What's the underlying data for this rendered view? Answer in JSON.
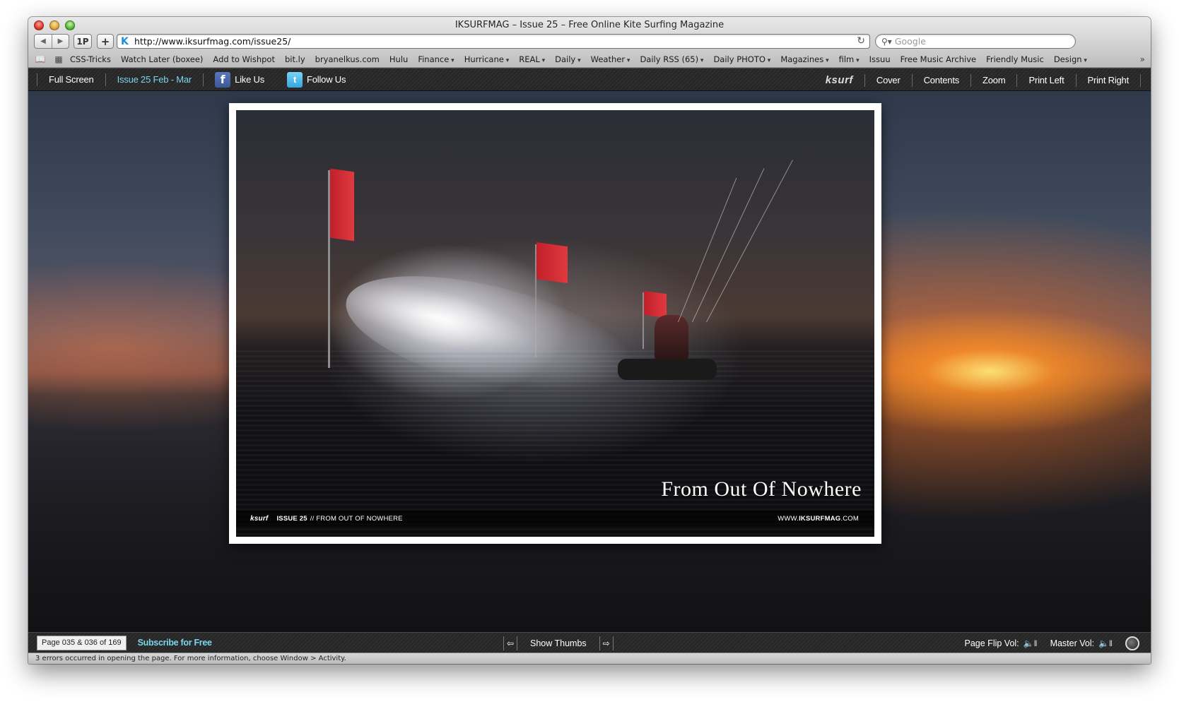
{
  "window": {
    "title": "IKSURFMAG – Issue 25 – Free Online Kite Surfing Magazine"
  },
  "toolbar": {
    "back_label": "◀",
    "forward_label": "▶",
    "onepass_label": "1P",
    "add_label": "+",
    "favicon": "K",
    "url": "http://www.iksurfmag.com/issue25/",
    "reload_icon": "↻",
    "search_placeholder": "Google"
  },
  "bookmarks": [
    {
      "label": "CSS-Tricks",
      "menu": false
    },
    {
      "label": "Watch Later (boxee)",
      "menu": false
    },
    {
      "label": "Add to Wishpot",
      "menu": false
    },
    {
      "label": "bit.ly",
      "menu": false
    },
    {
      "label": "bryanelkus.com",
      "menu": false
    },
    {
      "label": "Hulu",
      "menu": false
    },
    {
      "label": "Finance",
      "menu": true
    },
    {
      "label": "Hurricane",
      "menu": true
    },
    {
      "label": "REAL",
      "menu": true
    },
    {
      "label": "Daily",
      "menu": true
    },
    {
      "label": "Weather",
      "menu": true
    },
    {
      "label": "Daily RSS (65)",
      "menu": true
    },
    {
      "label": "Daily PHOTO",
      "menu": true
    },
    {
      "label": "Magazines",
      "menu": true
    },
    {
      "label": "film",
      "menu": true
    },
    {
      "label": "Issuu",
      "menu": false
    },
    {
      "label": "Free Music Archive",
      "menu": false
    },
    {
      "label": "Friendly Music",
      "menu": false
    },
    {
      "label": "Design",
      "menu": true
    }
  ],
  "app_nav": {
    "full_screen": "Full Screen",
    "issue": "Issue 25 Feb - Mar",
    "like": "Like Us",
    "follow": "Follow Us",
    "logo": "ksurf",
    "cover": "Cover",
    "contents": "Contents",
    "zoom": "Zoom",
    "print_left": "Print Left",
    "print_right": "Print Right"
  },
  "page": {
    "caption": "From Out Of Nowhere",
    "bar_logo": "ksurf",
    "bar_issue": "ISSUE 25",
    "bar_title": "// FROM OUT OF NOWHERE",
    "site_prefix": "WWW.",
    "site_bold": "IKSURFMAG",
    "site_suffix": ".COM"
  },
  "bottom": {
    "page_label": "Page",
    "page_current": "035 & 036",
    "page_of": "of",
    "page_total": "169",
    "subscribe": "Subscribe for Free",
    "show_thumbs": "Show Thumbs",
    "page_flip_vol": "Page Flip Vol:",
    "master_vol": "Master Vol:"
  },
  "status": "3 errors occurred in opening the page. For more information, choose Window > Activity."
}
